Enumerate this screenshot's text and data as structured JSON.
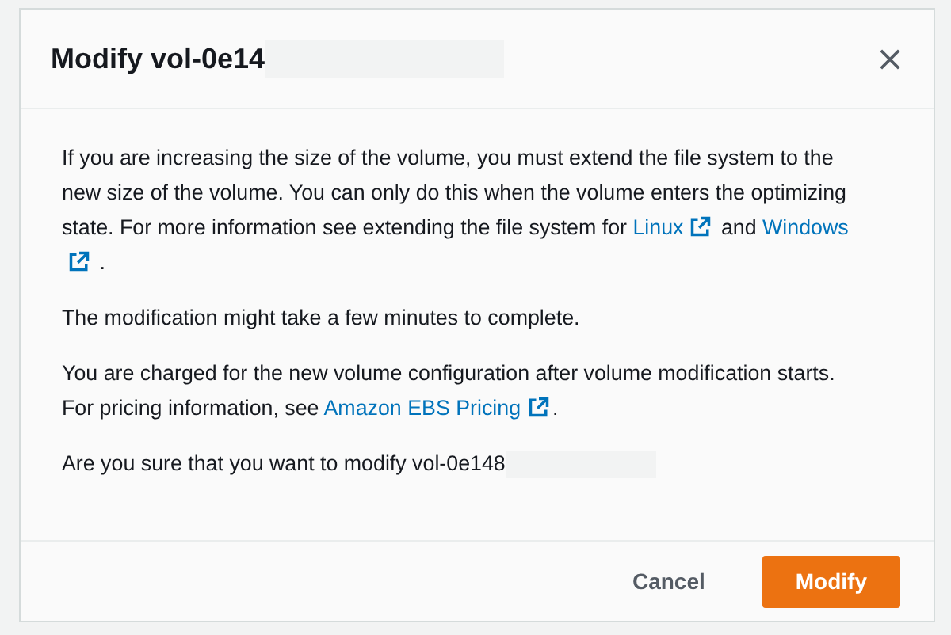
{
  "dialog": {
    "title": "Modify vol-0e14",
    "title_redacted": true,
    "paragraphs": [
      {
        "parts": [
          {
            "kind": "text",
            "text": "If you are increasing the size of the volume, you must extend the file system to the new size of the volume. You can only do this when the volume enters the optimizing state. For more information see extending the file system for "
          },
          {
            "kind": "link",
            "text": "Linux"
          },
          {
            "kind": "text",
            "text": " and "
          },
          {
            "kind": "link",
            "text": "Windows"
          },
          {
            "kind": "text",
            "text": " ."
          }
        ]
      },
      {
        "parts": [
          {
            "kind": "text",
            "text": "The modification might take a few minutes to complete."
          }
        ]
      },
      {
        "parts": [
          {
            "kind": "text",
            "text": "You are charged for the new volume configuration after volume modification starts. For pricing information, see "
          },
          {
            "kind": "link",
            "text": "Amazon EBS Pricing"
          },
          {
            "kind": "text",
            "text": "."
          }
        ]
      },
      {
        "parts": [
          {
            "kind": "text",
            "text": "Are you sure that you want to modify vol-0e148"
          },
          {
            "kind": "redacted"
          }
        ]
      }
    ],
    "buttons": [
      {
        "label": "Cancel",
        "kind": "link"
      },
      {
        "label": "Modify",
        "kind": "primary"
      }
    ]
  }
}
